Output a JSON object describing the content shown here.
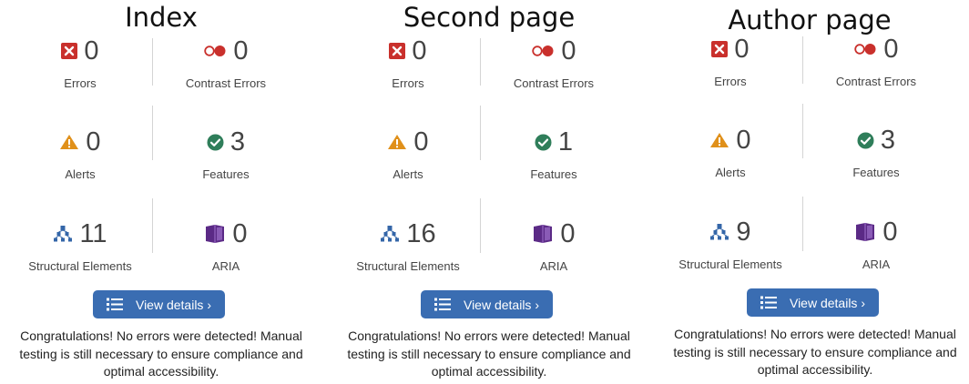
{
  "panels": [
    {
      "title": "Index",
      "stats": {
        "errors": {
          "value": "0",
          "label": "Errors"
        },
        "contrast": {
          "value": "0",
          "label": "Contrast Errors"
        },
        "alerts": {
          "value": "0",
          "label": "Alerts"
        },
        "features": {
          "value": "3",
          "label": "Features"
        },
        "structural": {
          "value": "11",
          "label": "Structural Elements"
        },
        "aria": {
          "value": "0",
          "label": "ARIA"
        }
      },
      "button_label": "View details ›",
      "message": "Congratulations! No errors were detected! Manual testing is still necessary to ensure compliance and optimal accessibility."
    },
    {
      "title": "Second page",
      "stats": {
        "errors": {
          "value": "0",
          "label": "Errors"
        },
        "contrast": {
          "value": "0",
          "label": "Contrast Errors"
        },
        "alerts": {
          "value": "0",
          "label": "Alerts"
        },
        "features": {
          "value": "1",
          "label": "Features"
        },
        "structural": {
          "value": "16",
          "label": "Structural Elements"
        },
        "aria": {
          "value": "0",
          "label": "ARIA"
        }
      },
      "button_label": "View details ›",
      "message": "Congratulations! No errors were detected! Manual testing is still necessary to ensure compliance and optimal accessibility."
    },
    {
      "title": "Author page",
      "stats": {
        "errors": {
          "value": "0",
          "label": "Errors"
        },
        "contrast": {
          "value": "0",
          "label": "Contrast Errors"
        },
        "alerts": {
          "value": "0",
          "label": "Alerts"
        },
        "features": {
          "value": "3",
          "label": "Features"
        },
        "structural": {
          "value": "9",
          "label": "Structural Elements"
        },
        "aria": {
          "value": "0",
          "label": "ARIA"
        }
      },
      "button_label": "View details ›",
      "message": "Congratulations! No errors were detected! Manual testing is still necessary to ensure compliance and optimal accessibility."
    }
  ],
  "icons": {
    "errors": "error-x-icon",
    "contrast": "contrast-icon",
    "alerts": "alert-triangle-icon",
    "features": "feature-check-icon",
    "structural": "structure-tree-icon",
    "aria": "aria-box-icon",
    "button": "list-icon"
  },
  "colors": {
    "error": "#c9302c",
    "alert": "#e0901a",
    "feature": "#2f7e5a",
    "structural": "#3466a8",
    "aria": "#5b2a86",
    "button": "#3a6db2"
  }
}
